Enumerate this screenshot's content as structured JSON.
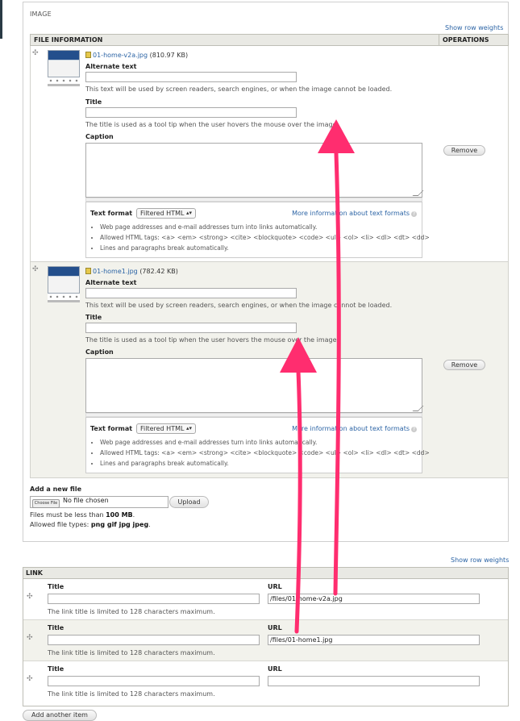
{
  "image_field": {
    "legend": "IMAGE",
    "show_row_weights": "Show row weights",
    "col_file_info": "FILE INFORMATION",
    "col_operations": "OPERATIONS",
    "files": [
      {
        "name": "01-home-v2a.jpg",
        "size": "(810.97 KB)",
        "alt_label": "Alternate text",
        "alt_desc": "This text will be used by screen readers, search engines, or when the image cannot be loaded.",
        "title_label": "Title",
        "title_desc": "The title is used as a tool tip when the user hovers the mouse over the image.",
        "caption_label": "Caption",
        "remove_label": "Remove"
      },
      {
        "name": "01-home1.jpg",
        "size": "(782.42 KB)",
        "alt_label": "Alternate text",
        "alt_desc": "This text will be used by screen readers, search engines, or when the image cannot be loaded.",
        "title_label": "Title",
        "title_desc": "The title is used as a tool tip when the user hovers the mouse over the image.",
        "caption_label": "Caption",
        "remove_label": "Remove"
      }
    ],
    "text_format": {
      "label": "Text format",
      "selected": "Filtered HTML",
      "more_link": "More information about text formats",
      "tips": [
        "Web page addresses and e-mail addresses turn into links automatically.",
        "Allowed HTML tags: <a> <em> <strong> <cite> <blockquote> <code> <ul> <ol> <li> <dl> <dt> <dd>",
        "Lines and paragraphs break automatically."
      ]
    },
    "add_file": {
      "label": "Add a new file",
      "choose_button": "Choose File",
      "no_file": "No file chosen",
      "upload_button": "Upload",
      "limit_prefix": "Files must be less than ",
      "limit_value": "100 MB",
      "types_prefix": "Allowed file types: ",
      "types_value": "png gif jpg jpeg"
    }
  },
  "link_field": {
    "legend": "LINK",
    "show_row_weights": "Show row weights",
    "rows": [
      {
        "title_label": "Title",
        "url_label": "URL",
        "title_value": "",
        "url_value": "/files/01-home-v2a.jpg",
        "desc": "The link title is limited to 128 characters maximum."
      },
      {
        "title_label": "Title",
        "url_label": "URL",
        "title_value": "",
        "url_value": "/files/01-home1.jpg",
        "desc": "The link title is limited to 128 characters maximum."
      },
      {
        "title_label": "Title",
        "url_label": "URL",
        "title_value": "",
        "url_value": "",
        "desc": "The link title is limited to 128 characters maximum."
      }
    ],
    "add_another": "Add another item"
  },
  "colors": {
    "link": "#2c64a5",
    "annotation_arrow": "#ff2d6f",
    "header_bg": "#e9e9e4",
    "even_row_bg": "#f2f2ec"
  },
  "icons": {
    "drag_handle": "drag-handle-icon",
    "file_type": "image-file-icon",
    "help": "help-icon",
    "dropdown": "chevron-down-icon"
  }
}
